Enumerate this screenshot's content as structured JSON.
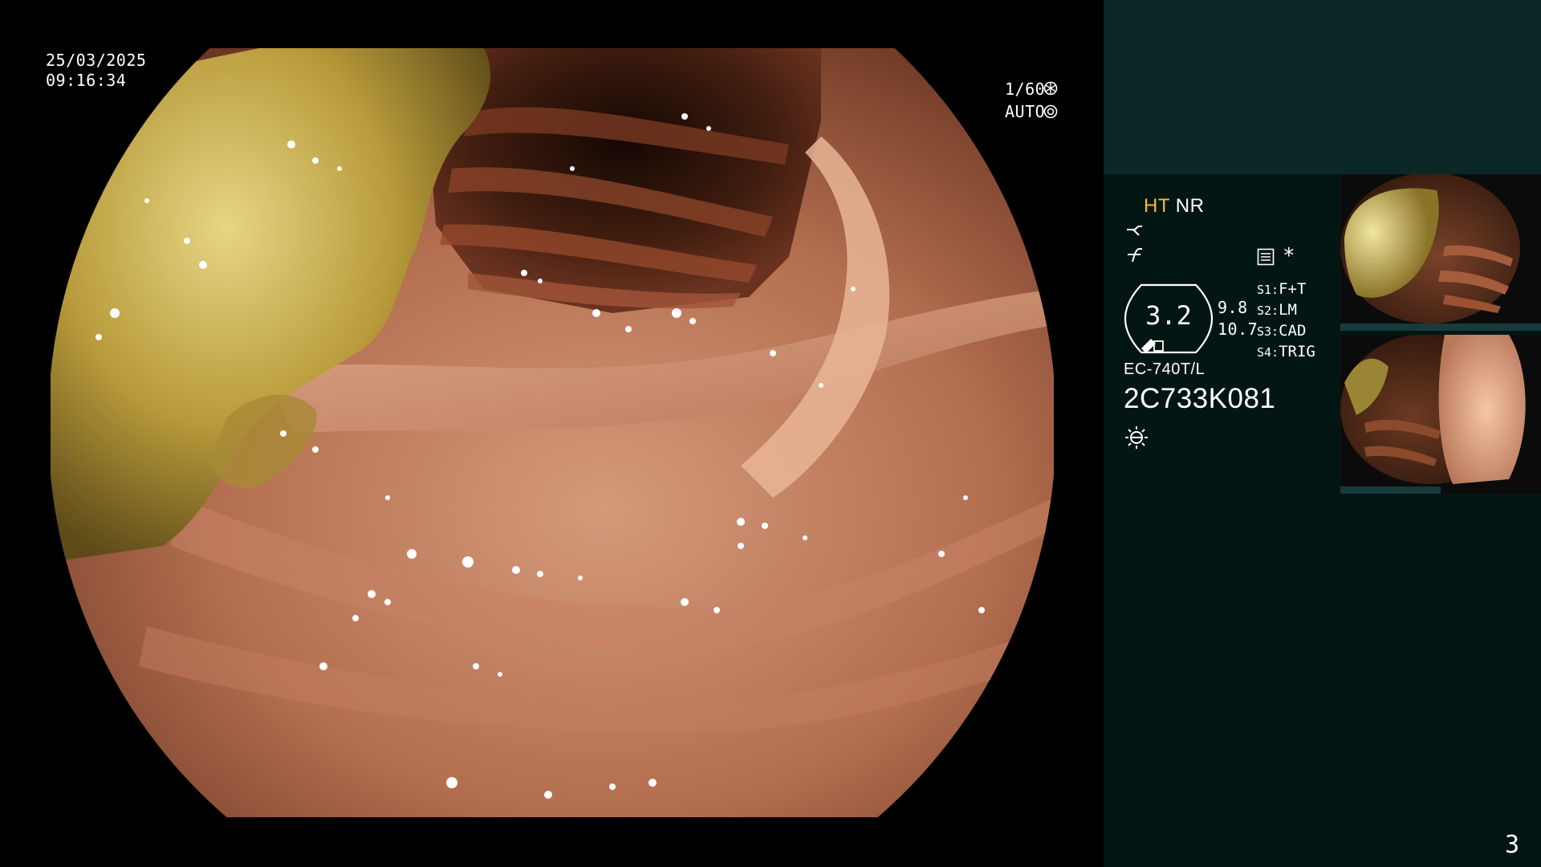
{
  "overlay": {
    "date": "25/03/2025",
    "time": "09:16:34",
    "shutter": "1/60",
    "exposure_mode": "AUTO"
  },
  "panel": {
    "ht_label": "HT",
    "nr_label": "NR",
    "zoom_value": "3.2",
    "value_top": "9.8",
    "value_bottom": "10.7",
    "switches": [
      {
        "key": "S1:",
        "value": "F+T"
      },
      {
        "key": "S2:",
        "value": "LM"
      },
      {
        "key": "S3:",
        "value": "CAD"
      },
      {
        "key": "S4:",
        "value": "TRIG"
      }
    ],
    "asterisk": "*",
    "scope_model": "EC-740T/L",
    "serial": "2C733K081",
    "page_number": "3"
  },
  "icons": {
    "shutter": "aperture-icon",
    "auto": "iris-icon",
    "curve1": "tone-curve-icon",
    "curve2": "enhance-icon",
    "memo": "record-icon",
    "light": "sun-icon"
  },
  "colors": {
    "panel_bg": "#041613",
    "panel_top_bg": "#0b2826",
    "ht_color": "#f4b93b"
  }
}
